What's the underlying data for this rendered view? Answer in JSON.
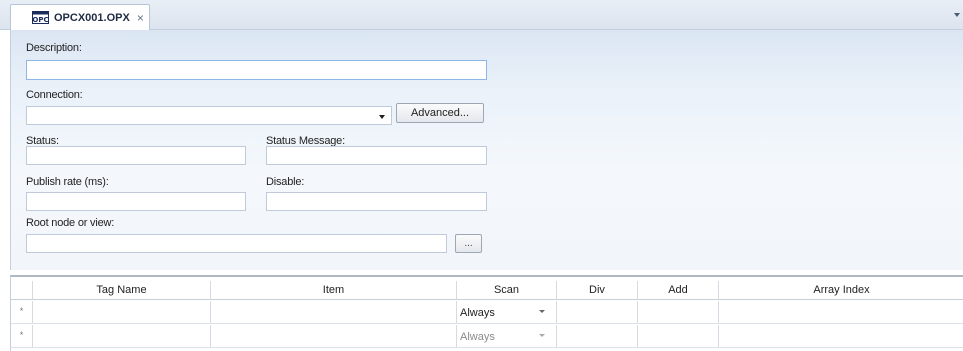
{
  "tab": {
    "title": "OPCX001.OPX",
    "icon": "opc-document-icon",
    "close_glyph": "×"
  },
  "form": {
    "description": {
      "label": "Description:",
      "value": ""
    },
    "connection": {
      "label": "Connection:",
      "value": "",
      "advanced_label": "Advanced..."
    },
    "status": {
      "label": "Status:",
      "value": ""
    },
    "status_message": {
      "label": "Status Message:",
      "value": ""
    },
    "publish_rate": {
      "label": "Publish rate (ms):",
      "value": ""
    },
    "disable": {
      "label": "Disable:",
      "value": ""
    },
    "root_node": {
      "label": "Root node or view:",
      "value": "",
      "browse_label": "..."
    }
  },
  "grid": {
    "columns": [
      "Tag Name",
      "Item",
      "Scan",
      "Div",
      "Add",
      "Array Index"
    ],
    "rows": [
      {
        "marker": "*",
        "tag_name": "",
        "item": "",
        "scan": "Always",
        "div": "",
        "add": "",
        "array_index": ""
      },
      {
        "marker": "*",
        "tag_name": "",
        "item": "",
        "scan": "Always",
        "div": "",
        "add": "",
        "array_index": ""
      }
    ]
  },
  "colors": {
    "tab_strip": "#dce4ef",
    "form_background": "#eaf1f9",
    "field_border": "#bfcadb",
    "focus_border": "#8fb6e8"
  }
}
